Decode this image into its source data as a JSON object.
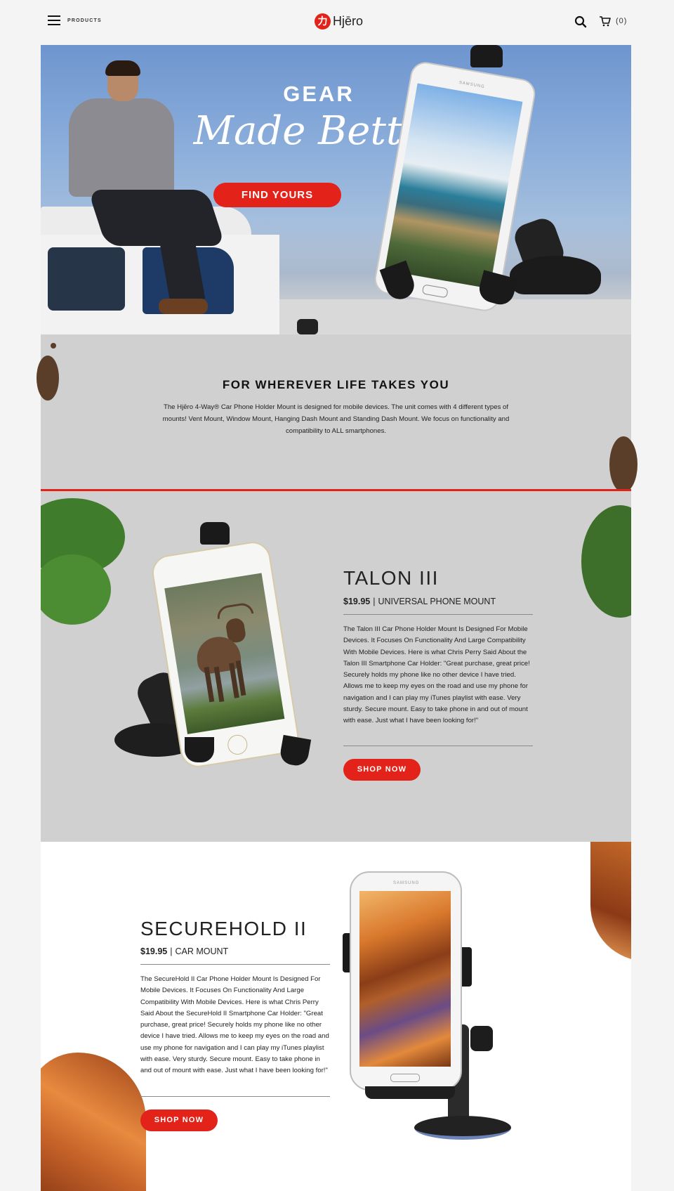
{
  "header": {
    "menu_label": "PRODUCTS",
    "logo_mark": "力",
    "logo_text": "Hjēro",
    "cart_count": "(0)",
    "icons": {
      "menu": "hamburger-icon",
      "search": "search-icon",
      "cart": "cart-icon"
    }
  },
  "hero": {
    "title_line1": "GEAR",
    "title_line2": "Made Better",
    "cta_label": "FIND YOURS",
    "phone_brand": "SAMSUNG"
  },
  "intro": {
    "heading": "FOR WHEREVER LIFE TAKES YOU",
    "body": "The Hjēro 4-Way® Car Phone Holder Mount is designed for mobile devices. The unit comes with 4 different types of mounts! Vent Mount, Window Mount, Hanging Dash Mount and Standing Dash Mount. We focus on functionality and compatibility to ALL smartphones."
  },
  "products": [
    {
      "title": "TALON III",
      "price": "$19.95",
      "subtitle": "UNIVERSAL PHONE MOUNT",
      "description": "The Talon III Car Phone Holder Mount Is Designed For Mobile Devices. It Focuses On Functionality And Large Compatibility With Mobile Devices. Here is what Chris Perry Said About the Talon III Smartphone Car Holder: \"Great purchase, great price! Securely holds my phone like no other device I have tried. Allows me to keep my eyes on the road and use my phone for navigation and I can play my iTunes playlist with ease. Very sturdy. Secure mount. Easy to take phone in and out of mount with ease. Just what I have been looking for!\"",
      "cta_label": "SHOP NOW"
    },
    {
      "title": "SECUREHOLD II",
      "price": "$19.95",
      "subtitle": "CAR MOUNT",
      "description": "The SecureHold II Car Phone Holder Mount Is Designed For Mobile Devices. It Focuses On Functionality And Large Compatibility With Mobile Devices. Here is what Chris Perry Said About the SecureHold II Smartphone Car Holder: \"Great purchase, great price! Securely holds my phone like no other device I have tried. Allows me to keep my eyes on the road and use my phone for navigation and I can play my iTunes playlist with ease. Very sturdy. Secure mount. Easy to take phone in and out of mount with ease. Just what I have been looking for!\"",
      "cta_label": "SHOP NOW",
      "phone_brand": "SAMSUNG"
    }
  ],
  "colors": {
    "accent": "#e32219",
    "section_gray": "#d0d0d0",
    "page_bg": "#f4f4f4"
  }
}
